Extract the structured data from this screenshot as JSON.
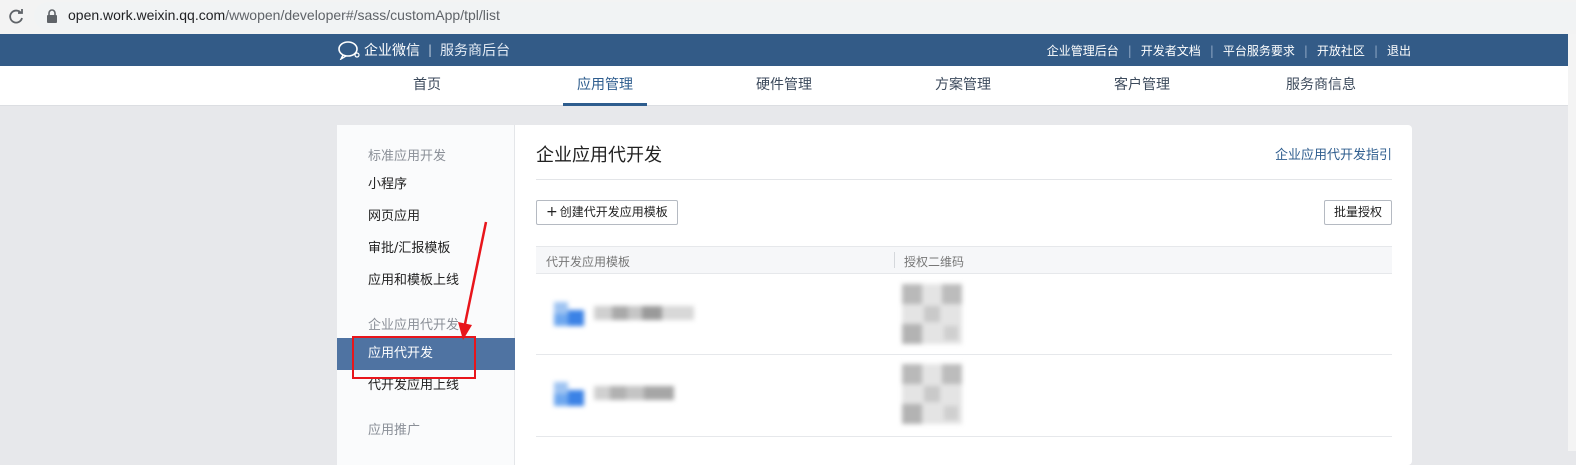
{
  "browser": {
    "url_host": "open.work.weixin.qq.com",
    "url_path": "/wwopen/developer#/sass/customApp/tpl/list"
  },
  "header": {
    "brand": "企业微信",
    "separator": "|",
    "subtitle": "服务商后台",
    "links": [
      "企业管理后台",
      "开发者文档",
      "平台服务要求",
      "开放社区",
      "退出"
    ]
  },
  "nav": {
    "tabs": [
      "首页",
      "应用管理",
      "硬件管理",
      "方案管理",
      "客户管理",
      "服务商信息"
    ],
    "active": "应用管理"
  },
  "sidebar": {
    "group1": "标准应用开发",
    "items1": [
      "小程序",
      "网页应用",
      "审批/汇报模板",
      "应用和模板上线"
    ],
    "group2": "企业应用代开发",
    "items2": [
      "应用代开发",
      "代开发应用上线"
    ],
    "active": "应用代开发",
    "group3": "应用推广"
  },
  "main": {
    "title": "企业应用代开发",
    "guide_link": "企业应用代开发指引",
    "create_button": "创建代开发应用模板",
    "create_icon": "plus-icon",
    "batch_button": "批量授权",
    "columns": [
      "代开发应用模板",
      "授权二维码"
    ],
    "rows": [
      {
        "name": "",
        "qr": "qr-code"
      },
      {
        "name": "",
        "qr": "qr-code"
      }
    ]
  },
  "colors": {
    "header_bg": "#335b87",
    "accent": "#2e5d8e",
    "sidebar_active": "#4f73a2",
    "annotation": "#e8151b"
  }
}
